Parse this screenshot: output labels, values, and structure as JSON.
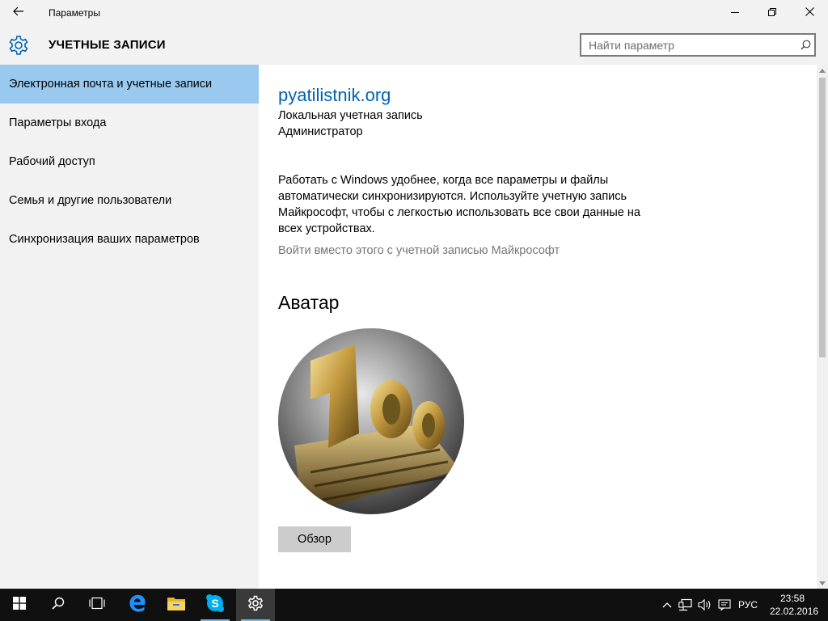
{
  "window": {
    "title": "Параметры"
  },
  "header": {
    "title": "УЧЕТНЫЕ ЗАПИСИ"
  },
  "search": {
    "placeholder": "Найти параметр",
    "value": ""
  },
  "sidebar": {
    "items": [
      {
        "label": "Электронная почта и учетные записи",
        "active": true
      },
      {
        "label": "Параметры входа",
        "active": false
      },
      {
        "label": "Рабочий доступ",
        "active": false
      },
      {
        "label": "Семья и другие пользователи",
        "active": false
      },
      {
        "label": "Синхронизация ваших параметров",
        "active": false
      }
    ]
  },
  "account": {
    "name": "pyatilistnik.org",
    "type": "Локальная учетная запись",
    "role": "Администратор",
    "promo": "Работать с Windows удобнее, когда все параметры и файлы автоматически синхронизируются. Используйте учетную запись Майкрософт, чтобы с легкостью использовать все свои данные на всех устройствах.",
    "ms_link": "Войти вместо этого с учетной записью Майкрософт"
  },
  "avatar": {
    "heading": "Аватар",
    "browse_label": "Обзор"
  },
  "taskbar": {
    "lang": "РУС",
    "time": "23:58",
    "date": "22.02.2016"
  },
  "colors": {
    "accent": "#0063b1",
    "nav_selected": "#99c9ef",
    "taskbar": "#101010",
    "link_gray": "#767676",
    "button_gray": "#cccccc"
  },
  "icons": {
    "back": "arrow-left-icon",
    "minimize": "minimize-icon",
    "maximize": "restore-icon",
    "close": "close-icon",
    "header": "gear-icon",
    "search": "search-icon",
    "taskbar": [
      "windows-logo-icon",
      "search-icon",
      "task-view-icon",
      "edge-icon",
      "file-explorer-icon",
      "skype-icon",
      "settings-gear-icon"
    ],
    "tray": [
      "chevron-up-icon",
      "network-icon",
      "volume-icon",
      "notifications-icon"
    ]
  }
}
